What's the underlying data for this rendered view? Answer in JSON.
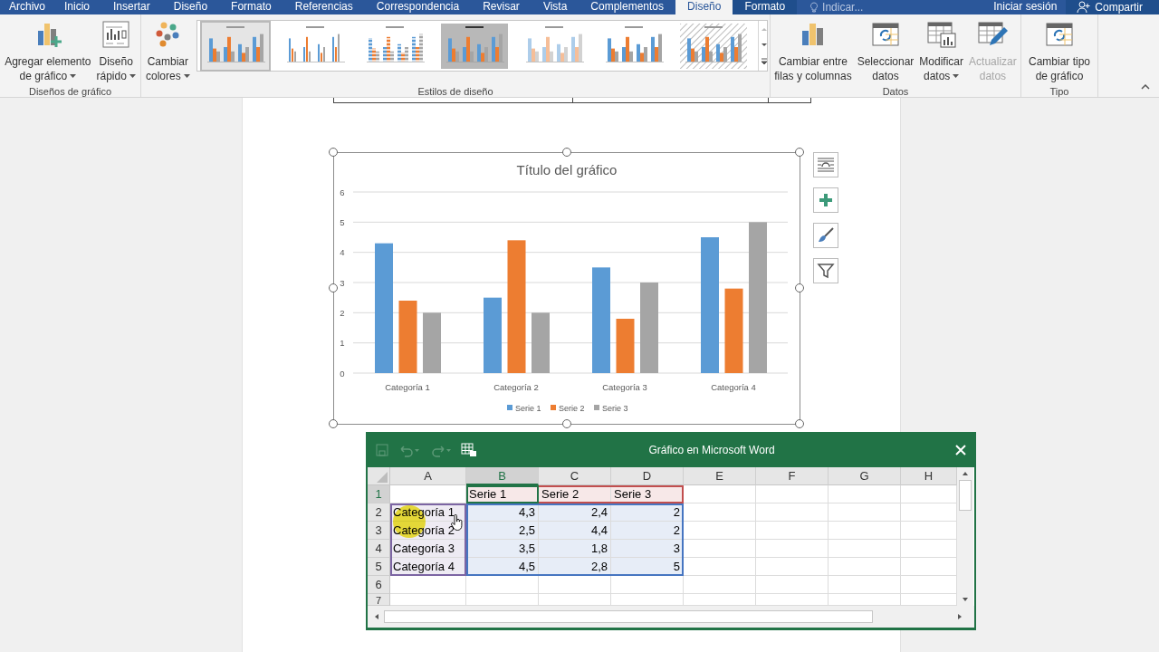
{
  "tabs": [
    {
      "label": "Archivo",
      "kind": "file",
      "selected": false
    },
    {
      "label": "Inicio",
      "kind": "normal",
      "selected": false
    },
    {
      "label": "Insertar",
      "kind": "normal",
      "selected": false
    },
    {
      "label": "Diseño",
      "kind": "normal",
      "selected": false
    },
    {
      "label": "Formato",
      "kind": "normal",
      "selected": false
    },
    {
      "label": "Referencias",
      "kind": "normal",
      "selected": false
    },
    {
      "label": "Correspondencia",
      "kind": "normal",
      "selected": false
    },
    {
      "label": "Revisar",
      "kind": "normal",
      "selected": false
    },
    {
      "label": "Vista",
      "kind": "normal",
      "selected": false
    },
    {
      "label": "Complementos",
      "kind": "normal",
      "selected": false
    },
    {
      "label": "Diseño",
      "kind": "contextual",
      "selected": true
    },
    {
      "label": "Formato",
      "kind": "contextual",
      "selected": false
    }
  ],
  "tell_me": {
    "placeholder": "Indicar..."
  },
  "account": {
    "sign_in": "Iniciar sesión",
    "share": "Compartir"
  },
  "ribbon": {
    "groups": [
      {
        "label": "Diseños de gráfico",
        "buttons": [
          {
            "lines": [
              "Agregar elemento",
              "de gráfico"
            ],
            "dropdown": true,
            "disabled": false
          },
          {
            "lines": [
              "Diseño",
              "rápido"
            ],
            "dropdown": true,
            "disabled": false
          }
        ]
      },
      {
        "label": "Estilos de diseño",
        "buttons": [
          {
            "lines": [
              "Cambiar",
              "colores"
            ],
            "dropdown": true,
            "disabled": false
          }
        ],
        "gallery": [
          {
            "kind": "plain",
            "selected": true
          },
          {
            "kind": "thin",
            "selected": false
          },
          {
            "kind": "striped",
            "selected": false
          },
          {
            "kind": "shaded",
            "selected": false
          },
          {
            "kind": "faded",
            "selected": false
          },
          {
            "kind": "plain",
            "selected": false
          },
          {
            "kind": "hatched",
            "selected": false
          }
        ]
      },
      {
        "label": "Datos",
        "buttons": [
          {
            "lines": [
              "Cambiar entre",
              "filas y columnas"
            ],
            "dropdown": false,
            "disabled": false
          },
          {
            "lines": [
              "Seleccionar",
              "datos"
            ],
            "dropdown": false,
            "disabled": false
          },
          {
            "lines": [
              "Modificar",
              "datos"
            ],
            "dropdown": true,
            "disabled": false
          },
          {
            "lines": [
              "Actualizar",
              "datos"
            ],
            "dropdown": false,
            "disabled": true
          }
        ]
      },
      {
        "label": "Tipo",
        "buttons": [
          {
            "lines": [
              "Cambiar tipo",
              "de gráfico"
            ],
            "dropdown": false,
            "disabled": false
          }
        ]
      }
    ]
  },
  "chart": {
    "chart_data": {
      "type": "bar",
      "title": "Título del gráfico",
      "categories": [
        "Categoría 1",
        "Categoría 2",
        "Categoría 3",
        "Categoría 4"
      ],
      "series": [
        {
          "name": "Serie 1",
          "color": "#5b9bd5",
          "values": [
            4.3,
            2.5,
            3.5,
            4.5
          ]
        },
        {
          "name": "Serie 2",
          "color": "#ed7d31",
          "values": [
            2.4,
            4.4,
            1.8,
            2.8
          ]
        },
        {
          "name": "Serie 3",
          "color": "#a5a5a5",
          "values": [
            2,
            2,
            3,
            5
          ]
        }
      ],
      "ylim": [
        0,
        6
      ],
      "yticks": [
        0,
        1,
        2,
        3,
        4,
        5,
        6
      ],
      "grid": true,
      "legend": true
    }
  },
  "sheet": {
    "title": "Gráfico en Microsoft Word",
    "columns": [
      {
        "label": "A",
        "selected": false
      },
      {
        "label": "B",
        "selected": true
      },
      {
        "label": "C",
        "selected": false
      },
      {
        "label": "D",
        "selected": false
      },
      {
        "label": "E",
        "selected": false
      },
      {
        "label": "F",
        "selected": false
      },
      {
        "label": "G",
        "selected": false
      },
      {
        "label": "H",
        "selected": false
      }
    ],
    "rows": [
      {
        "label": "1",
        "selected": true,
        "cells": [
          null,
          {
            "text": "Serie 1",
            "color": "#f7e8e8",
            "selected": true
          },
          {
            "text": "Serie 2",
            "color": "#f7e8e8",
            "selected": false
          },
          {
            "text": "Serie 3",
            "color": "#f7e8e8",
            "selected": false
          },
          null,
          null,
          null,
          null
        ]
      },
      {
        "label": "2",
        "selected": false,
        "cells": [
          {
            "text": "Categoría 1",
            "color": "#eeebf3",
            "selected": false
          },
          {
            "text": "4,3",
            "color": "#e7edf7",
            "selected": false
          },
          {
            "text": "2,4",
            "color": "#e7edf7",
            "selected": false
          },
          {
            "text": "2",
            "color": "#e7edf7",
            "selected": false
          },
          null,
          null,
          null,
          null
        ]
      },
      {
        "label": "3",
        "selected": false,
        "cells": [
          {
            "text": "Categoría 2",
            "color": "#eeebf3",
            "selected": false
          },
          {
            "text": "2,5",
            "color": "#e7edf7",
            "selected": false
          },
          {
            "text": "4,4",
            "color": "#e7edf7",
            "selected": false
          },
          {
            "text": "2",
            "color": "#e7edf7",
            "selected": false
          },
          null,
          null,
          null,
          null
        ]
      },
      {
        "label": "4",
        "selected": false,
        "cells": [
          {
            "text": "Categoría 3",
            "color": "#eeebf3",
            "selected": false
          },
          {
            "text": "3,5",
            "color": "#e7edf7",
            "selected": false
          },
          {
            "text": "1,8",
            "color": "#e7edf7",
            "selected": false
          },
          {
            "text": "3",
            "color": "#e7edf7",
            "selected": false
          },
          null,
          null,
          null,
          null
        ]
      },
      {
        "label": "5",
        "selected": false,
        "cells": [
          {
            "text": "Categoría 4",
            "color": "#eeebf3",
            "selected": false
          },
          {
            "text": "4,5",
            "color": "#e7edf7",
            "selected": false
          },
          {
            "text": "2,8",
            "color": "#e7edf7",
            "selected": false
          },
          {
            "text": "5",
            "color": "#e7edf7",
            "selected": false
          },
          null,
          null,
          null,
          null
        ]
      },
      {
        "label": "6",
        "selected": false,
        "cells": [
          null,
          null,
          null,
          null,
          null,
          null,
          null,
          null
        ]
      },
      {
        "label": "7",
        "selected": false,
        "cells": [
          null,
          null,
          null,
          null,
          null,
          null,
          null,
          null
        ]
      }
    ]
  }
}
